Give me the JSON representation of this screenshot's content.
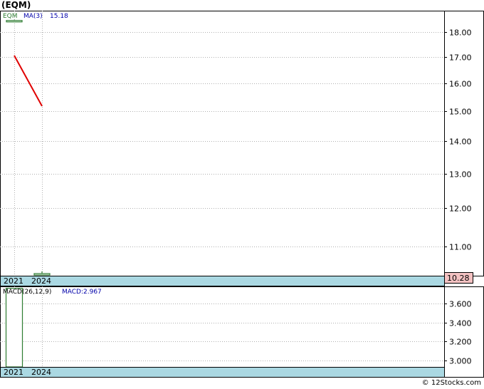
{
  "header": {
    "title": "(EQM)"
  },
  "footer": {
    "text": "© 12Stocks.com"
  },
  "colors": {
    "price_bar": "#2e7d32",
    "ma_line": "#e00000",
    "axis_band": "#aad8e2",
    "last_price_box": "#f4c2c2",
    "grid": "#b0b0b0"
  },
  "chart_data": [
    {
      "type": "line",
      "panel": "price",
      "legend": {
        "ticker": "EQM",
        "ma_label": "MA(3)",
        "ma_value": "15.18"
      },
      "x_labels": [
        "2021",
        "2024"
      ],
      "yticks": [
        11.0,
        12.0,
        13.0,
        14.0,
        15.0,
        16.0,
        17.0,
        18.0
      ],
      "ytick_labels": [
        "11.00",
        "12.00",
        "13.00",
        "14.00",
        "15.00",
        "16.00",
        "17.00",
        "18.00"
      ],
      "ylim": [
        10.28,
        18.9
      ],
      "scale": "log",
      "grid": true,
      "ohlc": [
        {
          "x": "2021",
          "open": 18.45,
          "high": 18.45,
          "low": 18.45,
          "close": 18.45
        },
        {
          "x": "2024",
          "open": 10.28,
          "high": 10.35,
          "low": 10.28,
          "close": 10.28
        }
      ],
      "series": [
        {
          "x": [
            "2021",
            "2024"
          ],
          "values": [
            17.05,
            15.18
          ]
        }
      ],
      "last_price": "10.28"
    },
    {
      "type": "bar",
      "panel": "macd",
      "legend": {
        "name": "MACD(26,12,9)",
        "value_label": "MACD:2.967"
      },
      "x_labels": [
        "2021",
        "2024"
      ],
      "yticks": [
        3.0,
        3.2,
        3.4,
        3.6
      ],
      "ytick_labels": [
        "3.000",
        "3.200",
        "3.400",
        "3.600"
      ],
      "ylim": [
        2.93,
        3.78
      ],
      "grid": true,
      "categories": [
        "2021"
      ],
      "values": [
        3.76
      ]
    }
  ]
}
